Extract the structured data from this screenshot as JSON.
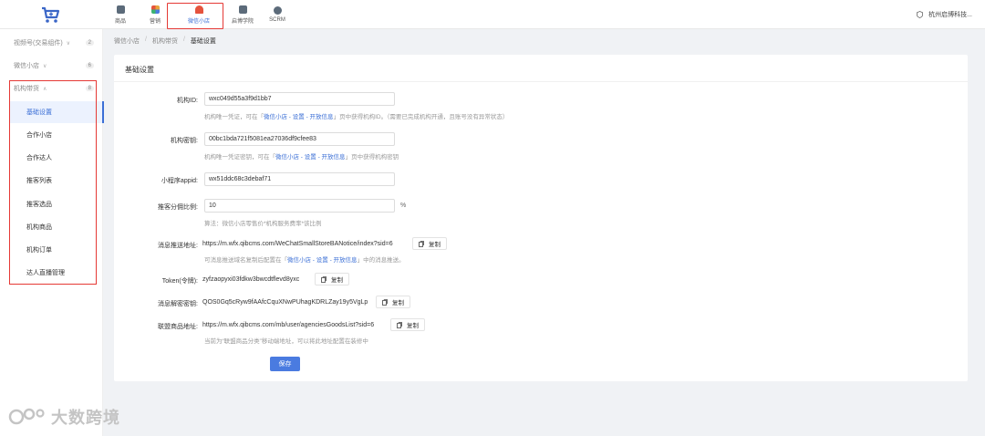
{
  "topnav": {
    "items": [
      {
        "label": "商品",
        "color": "#5c6b7a"
      },
      {
        "label": "营销",
        "color": "#e8a43a"
      },
      {
        "label": "微信小店",
        "color": "#e5533d"
      },
      {
        "label": "启博学院",
        "color": "#5c6b7a"
      },
      {
        "label": "SCRM",
        "color": "#5c6b7a"
      }
    ],
    "user_name": "杭州启博科技..."
  },
  "sidebar": {
    "groups": [
      {
        "label": "视频号(交易组件)",
        "count": "2"
      },
      {
        "label": "微信小店",
        "count": "6"
      },
      {
        "label": "机构带货",
        "count": "8"
      }
    ],
    "items": [
      {
        "label": "基础设置"
      },
      {
        "label": "合作小店"
      },
      {
        "label": "合作达人"
      },
      {
        "label": "推客列表"
      },
      {
        "label": "推客选品"
      },
      {
        "label": "机构商品"
      },
      {
        "label": "机构订单"
      },
      {
        "label": "达人直播管理"
      }
    ]
  },
  "breadcrumb": [
    "微信小店",
    "机构带货",
    "基础设置"
  ],
  "panel": {
    "title": "基础设置",
    "fields": {
      "org_id": {
        "label": "机构ID:",
        "value": "wxc049d55a3f9d1bb7",
        "hint_a": "机构唯一凭证，可在「",
        "hint_link": "微信小店 - 设置 - 开放信息",
        "hint_b": "」页中获得机构ID。（需要已完成机构开通，且账号没有异常状态）"
      },
      "org_secret": {
        "label": "机构密钥:",
        "value": "00bc1bda721f5081ea27036df9cfee83",
        "hint_a": "机构唯一凭证密钥，可在「",
        "hint_link": "微信小店 - 设置 - 开放信息",
        "hint_b": "」页中获得机构密钥"
      },
      "appid": {
        "label": "小程序appid:",
        "value": "wx51ddc68c3debaf71"
      },
      "ratio": {
        "label": "推客分佣比例:",
        "value": "10",
        "unit": "%",
        "hint": "算法：微信小店零售价*机构服务费率*该比例"
      },
      "push_url": {
        "label": "消息推送地址:",
        "value": "https://m.wfx.qibcms.com/WeChatSmallStoreBANotice/index?sid=6",
        "copy": "复制",
        "hint_a": "可消息推送域名复制后配置在「",
        "hint_link": "微信小店 - 设置 - 开放信息",
        "hint_b": "」中的消息推送。"
      },
      "token": {
        "label": "Token(令牌):",
        "value": "zyfzaopyxi03fdkw3bwcdtflevd8yxc",
        "copy": "复制"
      },
      "aes_key": {
        "label": "消息解密密钥:",
        "value": "QOS0Gq5cRyw9fAAfcCquXNwPUhagKDRLZay19y5VgLp",
        "copy": "复制"
      },
      "goods_url": {
        "label": "联盟商品地址:",
        "value": "https://m.wfx.qibcms.com/mb/user/agenciesGoodsList?sid=6",
        "copy": "复制",
        "hint": "当前为“联盟商品分类”移动端地址，可以将此地址配置在装修中"
      }
    },
    "save_label": "保存"
  },
  "watermark": "大数跨境"
}
